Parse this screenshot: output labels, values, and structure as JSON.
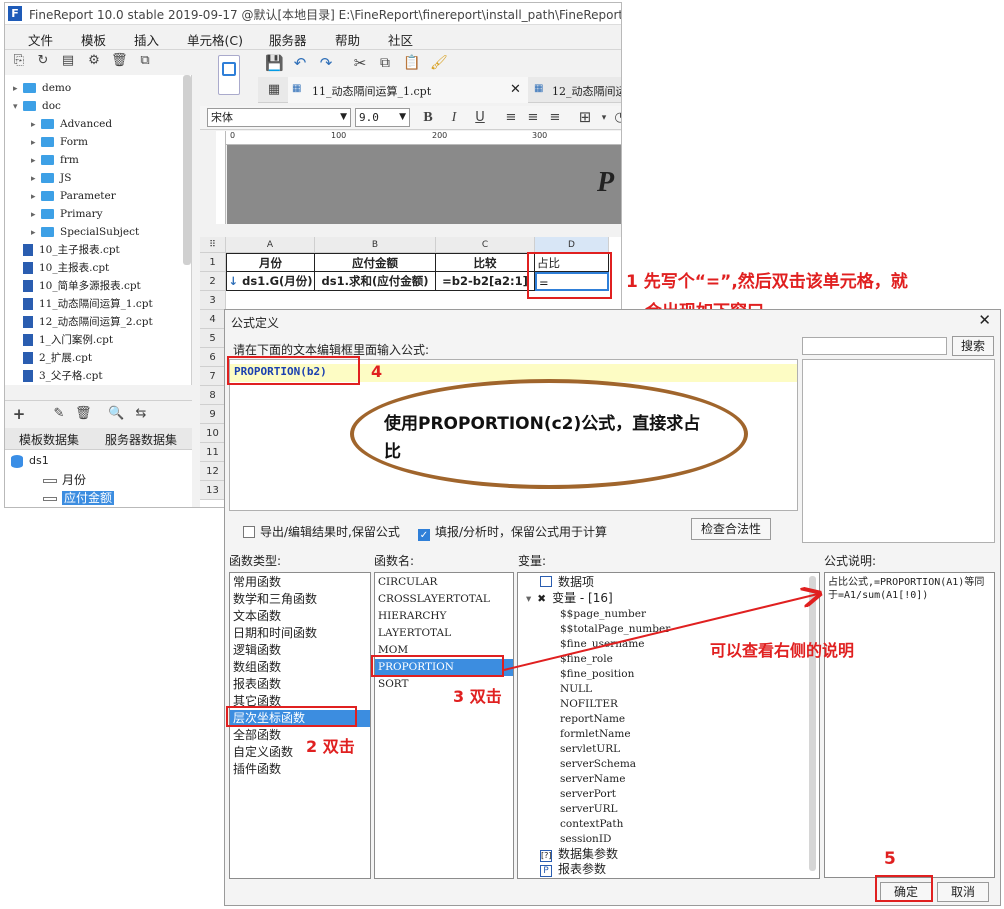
{
  "app": {
    "title": "FineReport 10.0 stable 2019-09-17 @默认[本地目录]     E:\\FineReport\\finereport\\install_path\\FineReport_",
    "menus": [
      "文件",
      "模板",
      "插入",
      "单元格(C)",
      "服务器",
      "帮助",
      "社区"
    ]
  },
  "tree": {
    "items": [
      {
        "label": "demo",
        "kind": "folder",
        "expanded": false,
        "depth": 0
      },
      {
        "label": "doc",
        "kind": "folder",
        "expanded": true,
        "depth": 0
      },
      {
        "label": "Advanced",
        "kind": "folder",
        "depth": 1
      },
      {
        "label": "Form",
        "kind": "folder",
        "depth": 1
      },
      {
        "label": "frm",
        "kind": "folder",
        "depth": 1
      },
      {
        "label": "JS",
        "kind": "folder",
        "depth": 1
      },
      {
        "label": "Parameter",
        "kind": "folder",
        "depth": 1
      },
      {
        "label": "Primary",
        "kind": "folder",
        "depth": 1
      },
      {
        "label": "SpecialSubject",
        "kind": "folder",
        "depth": 1
      },
      {
        "label": "10_主子报表.cpt",
        "kind": "file",
        "depth": 0
      },
      {
        "label": "10_主报表.cpt",
        "kind": "file",
        "depth": 0
      },
      {
        "label": "10_简单多源报表.cpt",
        "kind": "file",
        "depth": 0
      },
      {
        "label": "11_动态隔间运算_1.cpt",
        "kind": "file",
        "depth": 0
      },
      {
        "label": "12_动态隔间运算_2.cpt",
        "kind": "file",
        "depth": 0
      },
      {
        "label": "1_入门案例.cpt",
        "kind": "file",
        "depth": 0
      },
      {
        "label": "2_扩展.cpt",
        "kind": "file",
        "depth": 0
      },
      {
        "label": "3_父子格.cpt",
        "kind": "file",
        "depth": 0
      }
    ]
  },
  "datasets": {
    "tabs": [
      "模板数据集",
      "服务器数据集"
    ],
    "name": "ds1",
    "fields": [
      "月份",
      "应付金额"
    ]
  },
  "designer": {
    "file_tabs": [
      "11_动态隔间运算_1.cpt",
      "12_动态隔间运"
    ],
    "font_name": "宋体",
    "font_size": "9.0",
    "ruler_ticks": [
      "0",
      "100",
      "200",
      "300"
    ],
    "col_headers": [
      "A",
      "B",
      "C",
      "D"
    ],
    "row_numbers": [
      "1",
      "2",
      "3",
      "4",
      "5",
      "6",
      "7",
      "8",
      "9",
      "10",
      "11",
      "12",
      "13"
    ],
    "row1": [
      "月份",
      "应付金额",
      "比较",
      "占比"
    ],
    "row2": [
      "ds1.G(月份)",
      "ds1.求和(应付金额)",
      "=b2-b2[a2:1]",
      "="
    ]
  },
  "dialog": {
    "title": "公式定义",
    "prompt": "请在下面的文本编辑框里面输入公式:",
    "formula": "PROPORTION(b2)",
    "search_button": "搜索",
    "check_export": "导出/编辑结果时,保留公式",
    "check_fill": "填报/分析时，保留公式用于计算",
    "validate_button": "检查合法性",
    "func_type_label": "函数类型:",
    "func_name_label": "函数名:",
    "var_label": "变量:",
    "desc_label": "公式说明:",
    "func_types": [
      "常用函数",
      "数学和三角函数",
      "文本函数",
      "日期和时间函数",
      "逻辑函数",
      "数组函数",
      "报表函数",
      "其它函数",
      "层次坐标函数",
      "全部函数",
      "自定义函数",
      "插件函数"
    ],
    "func_names": [
      "CIRCULAR",
      "CROSSLAYERTOTAL",
      "HIERARCHY",
      "LAYERTOTAL",
      "MOM",
      "PROPORTION",
      "SORT"
    ],
    "var_data_item": "数据项",
    "var_group": "变量 - [16]",
    "variables": [
      "$$page_number",
      "$$totalPage_number",
      "$fine_username",
      "$fine_role",
      "$fine_position",
      "NULL",
      "NOFILTER",
      "reportName",
      "formletName",
      "servletURL",
      "serverSchema",
      "serverName",
      "serverPort",
      "serverURL",
      "contextPath",
      "sessionID"
    ],
    "var_ds_params": "数据集参数",
    "var_report_params": "报表参数",
    "description": "占比公式,=PROPORTION(A1)等同于=A1/sum(A1[!0])",
    "ok_button": "确定",
    "cancel_button": "取消"
  },
  "annotations": {
    "step1": "1 先写个“=”,然后双击该单元格，就",
    "step1b": "会出现如下窗口。",
    "step2": "2 双击",
    "step3": "3 双击",
    "step4": "4",
    "step5": "5",
    "bubble": "使用PROPORTION(c2)公式，直接求占比",
    "right_note": "可以查看右侧的说明"
  },
  "colors": {
    "accent": "#2f7fd8",
    "annotation": "#e02020",
    "bubble_border": "#a0652c",
    "select_bg": "#3c8de0"
  }
}
